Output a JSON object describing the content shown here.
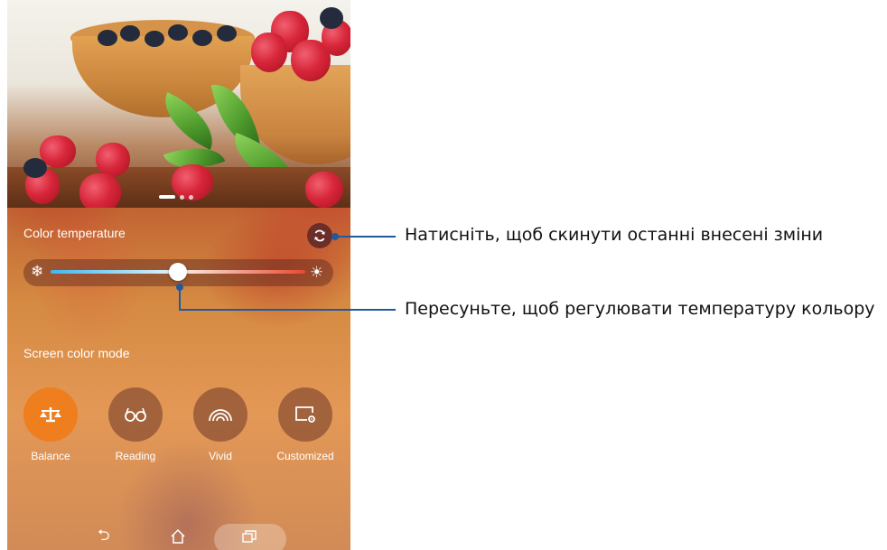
{
  "color_temperature": {
    "label": "Color temperature",
    "reset_icon": "refresh-icon",
    "cold_icon": "snowflake-icon",
    "warm_icon": "sun-icon",
    "slider_value": 0.5
  },
  "screen_color_mode": {
    "label": "Screen color mode",
    "modes": [
      {
        "label": "Balance",
        "icon": "balance-scale-icon",
        "active": true
      },
      {
        "label": "Reading",
        "icon": "glasses-icon",
        "active": false
      },
      {
        "label": "Vivid",
        "icon": "rainbow-icon",
        "active": false
      },
      {
        "label": "Customized",
        "icon": "custom-settings-icon",
        "active": false
      }
    ]
  },
  "navbar": {
    "back_icon": "back-icon",
    "home_icon": "home-icon",
    "recents_icon": "recents-icon"
  },
  "callouts": {
    "reset": "Натисніть, щоб скинути останні внесені зміни",
    "slider": "Пересуньте, щоб регулювати температуру кольору"
  },
  "colors": {
    "accent": "#ee7e1e",
    "callout_line": "#1f5b9a"
  }
}
